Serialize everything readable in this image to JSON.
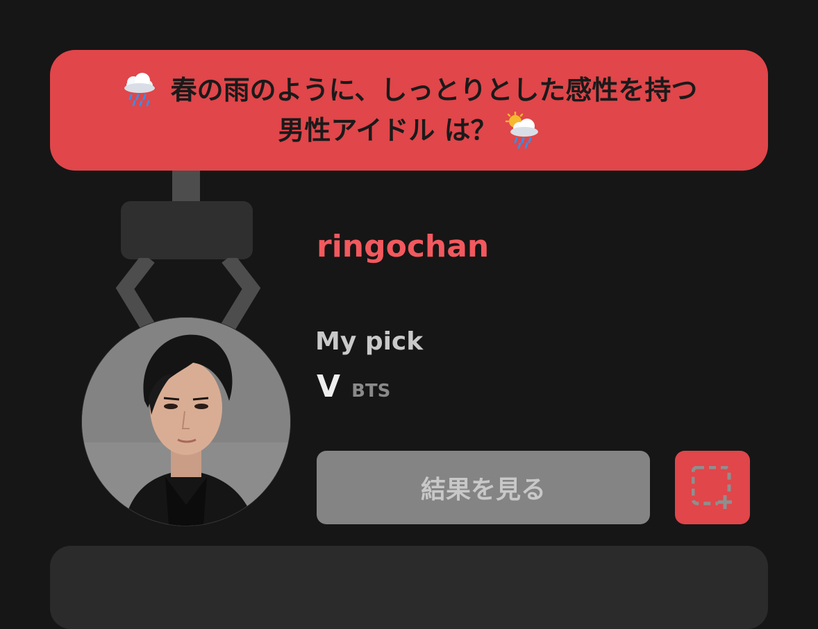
{
  "question": {
    "line1": "春の雨のように、しっとりとした感性を持つ",
    "line2": "男性アイドル は？",
    "lead_icon": "rain-cloud-icon",
    "trail_icon": "sun-behind-rain-cloud-icon"
  },
  "user": {
    "name": "ringochan"
  },
  "pick": {
    "label": "My pick",
    "name": "V",
    "group": "BTS"
  },
  "actions": {
    "result_label": "結果を見る",
    "capture_icon": "screenshot-icon"
  },
  "colors": {
    "background": "#161616",
    "accent": "#e0464a",
    "username": "#f2595e",
    "button_gray": "#848484"
  }
}
